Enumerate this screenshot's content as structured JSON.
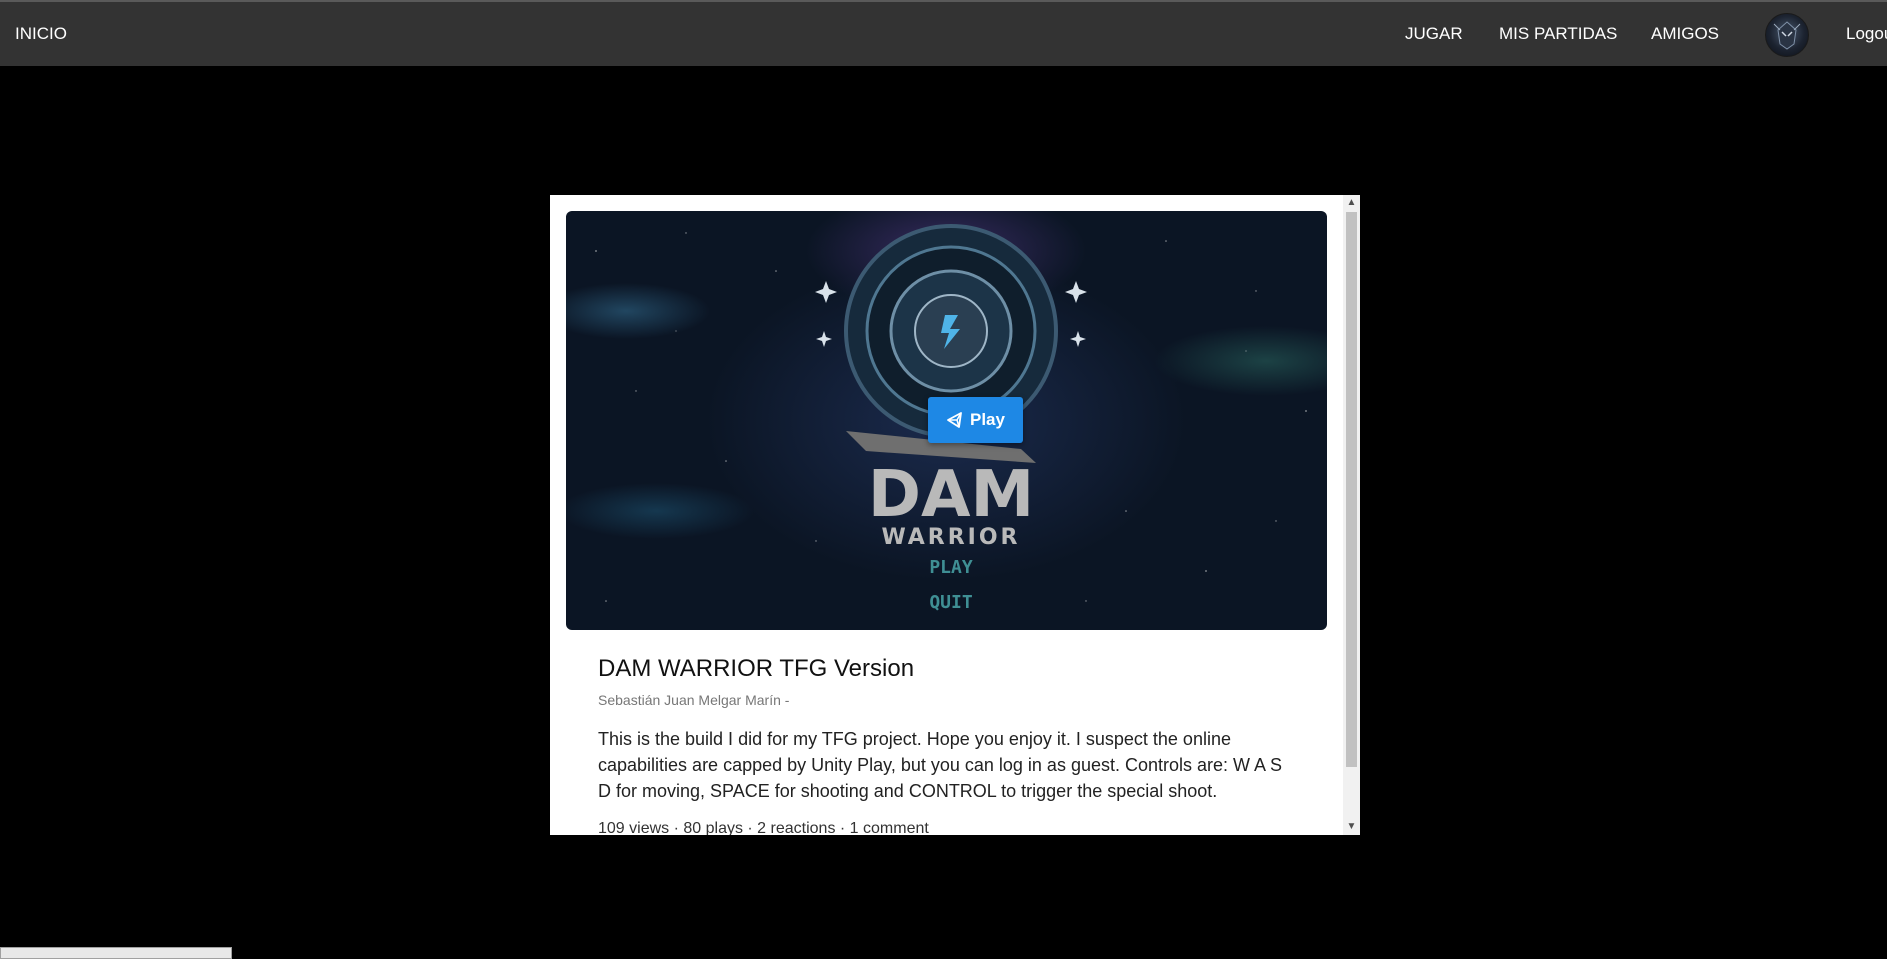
{
  "nav": {
    "home": "INICIO",
    "jugar": "JUGAR",
    "partidas": "MIS PARTIDAS",
    "amigos": "AMIGOS",
    "logout": "Logou"
  },
  "game": {
    "cover_title": "DAM",
    "cover_subtitle": "WARRIOR",
    "cover_menu": [
      "PLAY",
      "QUIT"
    ],
    "play_label": "Play",
    "title": "DAM WARRIOR TFG Version",
    "author": "Sebastián Juan Melgar Marín -",
    "description": "This is the build I did for my TFG project. Hope you enjoy it. I suspect the online capabilities are capped by Unity Play, but you can log in as guest. Controls are: W A S D for moving, SPACE for shooting and CONTROL to trigger the special shoot.",
    "stats": "109 views · 80 plays · 2 reactions · 1 comment"
  },
  "colors": {
    "navbar": "#333333",
    "play_button": "#1e88e5",
    "background": "#000000"
  }
}
